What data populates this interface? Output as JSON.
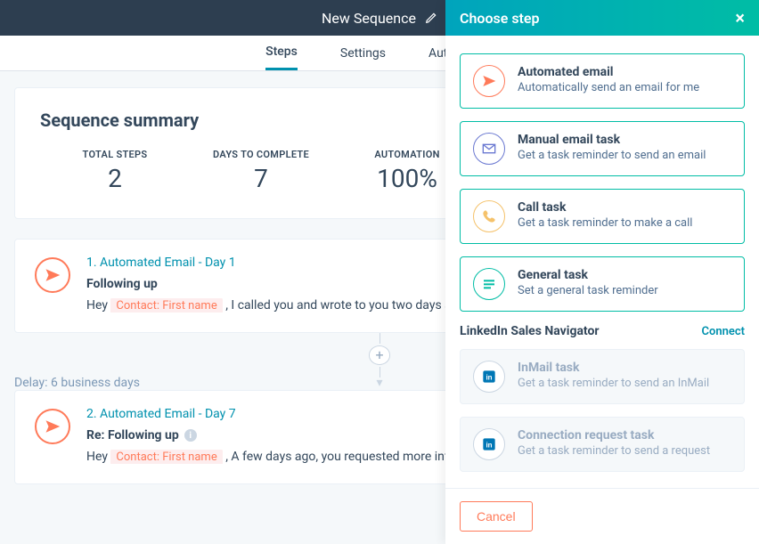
{
  "title_bar": {
    "title": "New Sequence"
  },
  "tabs": {
    "steps": "Steps",
    "settings": "Settings",
    "automation": "Automation"
  },
  "summary": {
    "heading": "Sequence summary",
    "total_steps_label": "TOTAL STEPS",
    "total_steps_value": "2",
    "days_label": "DAYS TO COMPLETE",
    "days_value": "7",
    "automation_label": "AUTOMATION",
    "automation_value": "100%"
  },
  "steps": {
    "s1": {
      "heading": "1. Automated Email - Day 1",
      "subject": "Following up",
      "body_pre": "Hey ",
      "token": "Contact: First name",
      "body_post": " , I called you and wrote to you two days ago about some"
    },
    "delay_label": "Delay:",
    "delay_value": "6 business days",
    "s2": {
      "heading": "2. Automated Email - Day 7",
      "subject": "Re: Following up",
      "body_pre": "Hey ",
      "token": "Contact: First name",
      "body_post": " , A few days ago, you requested more information about"
    }
  },
  "panel": {
    "header": "Choose step",
    "options": {
      "auto_email_title": "Automated email",
      "auto_email_desc": "Automatically send an email for me",
      "manual_email_title": "Manual email task",
      "manual_email_desc": "Get a task reminder to send an email",
      "call_title": "Call task",
      "call_desc": "Get a task reminder to make a call",
      "general_title": "General task",
      "general_desc": "Set a general task reminder"
    },
    "linkedin": {
      "section": "LinkedIn Sales Navigator",
      "connect": "Connect",
      "inmail_title": "InMail task",
      "inmail_desc": "Get a task reminder to send an InMail",
      "conn_title": "Connection request task",
      "conn_desc": "Get a task reminder to send a request"
    },
    "cancel": "Cancel"
  }
}
